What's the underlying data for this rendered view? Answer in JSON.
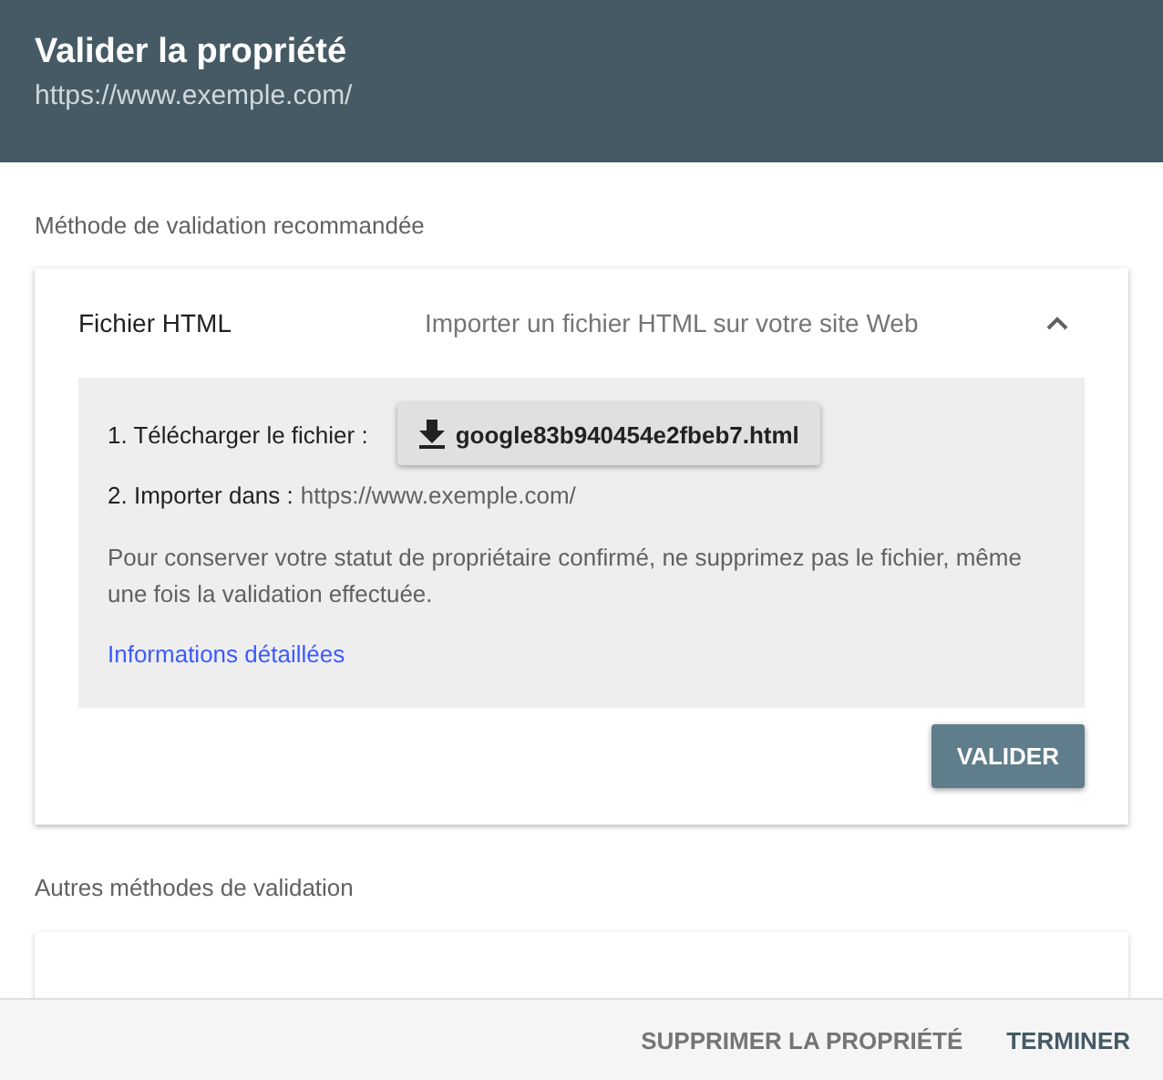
{
  "header": {
    "title": "Valider la propriété",
    "subtitle": "https://www.exemple.com/"
  },
  "recommended": {
    "heading": "Méthode de validation recommandée",
    "method": {
      "name": "Fichier HTML",
      "description": "Importer un fichier HTML sur votre site Web",
      "expanded": true,
      "step_1": {
        "label": "1. Télécharger le fichier :",
        "file_button": "google83b940454e2fbeb7.html"
      },
      "step_2": {
        "label": "2. Importer dans :",
        "value": "https://www.exemple.com/"
      },
      "note": "Pour conserver votre statut de propriétaire confirmé, ne supprimez pas le fichier, même une fois la validation effectuée.",
      "link": "Informations détaillées",
      "action": "VALIDER"
    }
  },
  "other": {
    "heading": "Autres méthodes de validation"
  },
  "footer": {
    "buttons": [
      {
        "label": "SUPPRIMER LA PROPRIÉTÉ",
        "kind": "secondary"
      },
      {
        "label": "TERMINER",
        "kind": "primary"
      }
    ]
  }
}
